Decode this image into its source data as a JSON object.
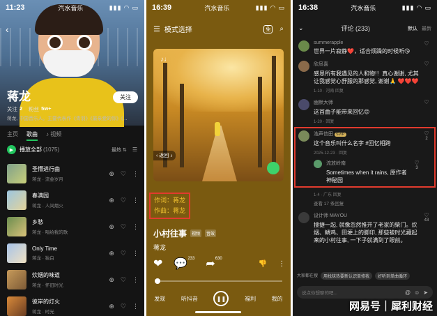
{
  "status": [
    {
      "time": "11:23",
      "app": "汽水音乐"
    },
    {
      "time": "16:39",
      "app": "汽水音乐"
    },
    {
      "time": "16:38",
      "app": "汽水音乐"
    }
  ],
  "artist_page": {
    "name": "蒋龙",
    "follow_label": "关注",
    "stats": {
      "follow_label": "关注",
      "follow_value": "2",
      "fans_label": "粉丝",
      "fans_value": "5w+"
    },
    "bio": "蒋龙, 中国音乐人。主要代表作《青羽》《最亲爱的你》《...",
    "tabs": [
      "主页",
      "歌曲",
      "视频"
    ],
    "play_all": "播放全部",
    "count": "(1075)",
    "sort": "最热",
    "songs": [
      {
        "title": "圣懵进行曲",
        "sub": "蒋龙 · 流金岁月"
      },
      {
        "title": "春满园",
        "sub": "蒋龙 · 人间烟火"
      },
      {
        "title": "乡愁",
        "sub": "蒋龙 · 唱给我的歌"
      },
      {
        "title": "Only Time",
        "sub": "蒋龙 · 独白"
      },
      {
        "title": "炊烟的味道",
        "sub": "蒋龙 · 怀旧时光"
      },
      {
        "title": "彼岸的灯火",
        "sub": "蒋龙 · 时光"
      }
    ]
  },
  "player_page": {
    "header": "模式选择",
    "back_chip": "返回",
    "credits": {
      "lyricist": "作词：蒋龙",
      "composer": "作曲：蒋龙"
    },
    "song_title": "小村往事",
    "tags": [
      "视频",
      "音效"
    ],
    "artist": "蒋龙",
    "like_count": "",
    "comment_count": "233",
    "share_count": "630",
    "progress": 0.0,
    "nav": [
      "发现",
      "听抖音",
      "福利",
      "我的"
    ]
  },
  "comments_page": {
    "title": "评论 (233)",
    "segments": [
      "默认",
      "最新"
    ],
    "comments": [
      {
        "user": "summerapple",
        "text": "世界一片寂静❤️，适合烦躁的时候听😘",
        "meta": "",
        "likes": ""
      },
      {
        "user": "欣凤喜",
        "text": "感恩所有我遇见的人和物!！真心谢谢, 尤其让我感觉心舒服的那感觉, 谢谢🙏 ❤️❤️❤️",
        "meta": "1-10 · 河南 回复",
        "likes": ""
      },
      {
        "user": "幽默大师",
        "text": "这首曲子能带来回忆😊",
        "meta": "1-20 · 回复",
        "likes": ""
      }
    ],
    "highlight": {
      "user": "浩声信田",
      "badge": "SVIP",
      "text": "这个音乐叫什么名字 #回忆相跨",
      "meta": "2025-12-23 · 回复",
      "likes": "2",
      "reply": {
        "user": "流放岭南",
        "text": "Sometimes when it rains, 原作者神秘园",
        "meta": "1-4 · 广东 回复",
        "likes": "3"
      },
      "expand": "查看 17 条回复"
    },
    "last": {
      "user": "设计师 MAYOU",
      "text": "搜捷一起, 就像忽然推开了老家的柴门。炊烟、鳞鸡、田埂上的脚印, 那些被时光藏起来的小村往事, 一下子就满到了眼前。",
      "likes": "43"
    },
    "hint_label": "大家都在搜",
    "hint_chips": [
      "用找袜热要新认识单修我",
      "好听到单曲循环"
    ],
    "input_placeholder": "说点你想聊的吧...",
    "watermark": "网易号｜犀利财经"
  }
}
